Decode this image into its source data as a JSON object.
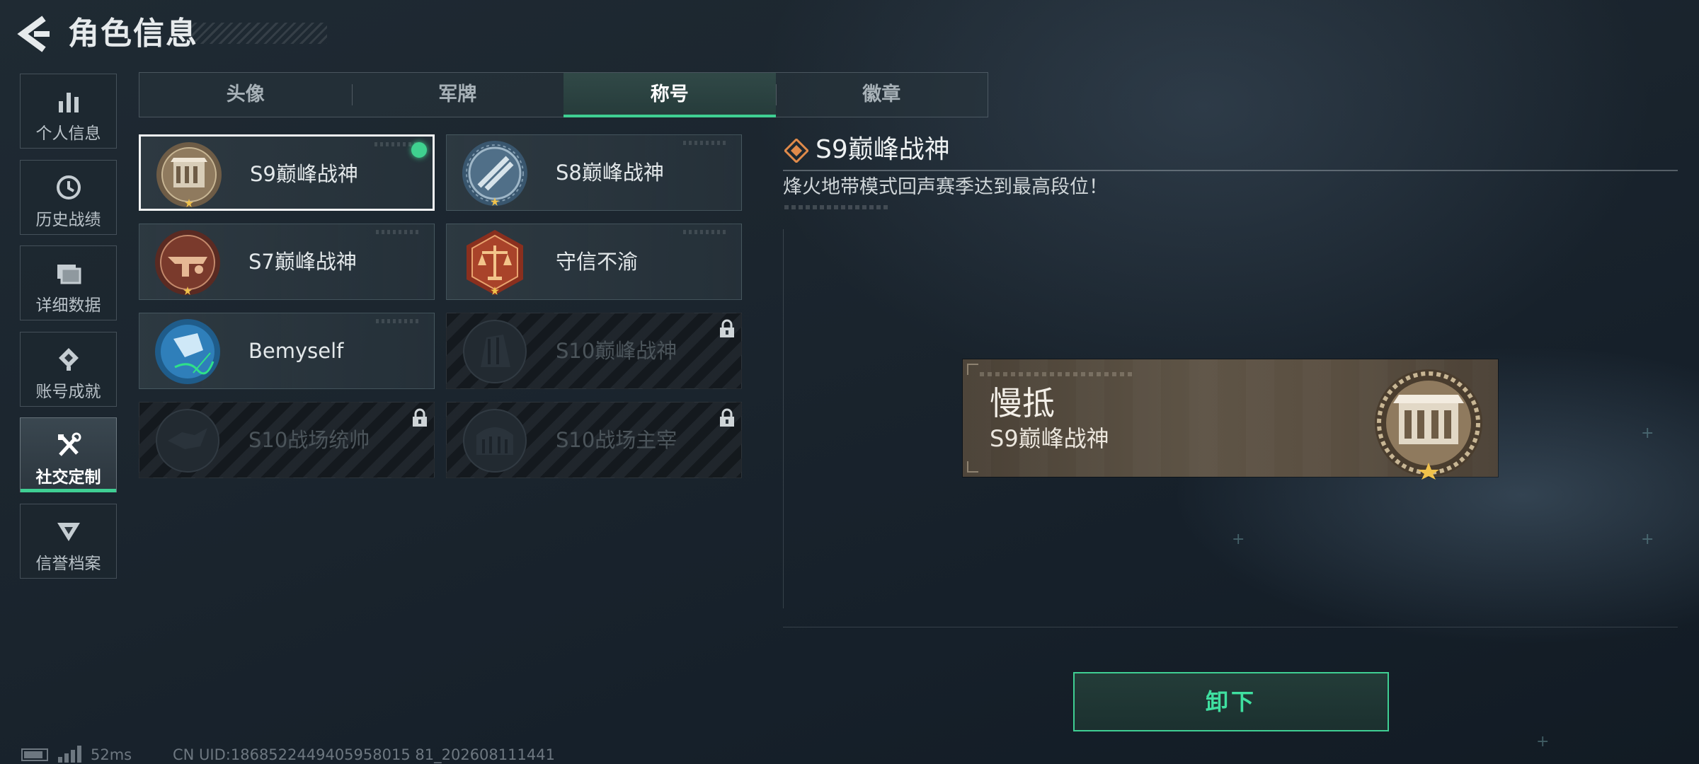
{
  "header": {
    "title": "角色信息"
  },
  "sidebar": {
    "items": [
      {
        "label": "个人信息",
        "icon": "bar-chart-icon"
      },
      {
        "label": "历史战绩",
        "icon": "clock-icon"
      },
      {
        "label": "详细数据",
        "icon": "folder-icon"
      },
      {
        "label": "账号成就",
        "icon": "achievement-icon"
      },
      {
        "label": "社交定制",
        "icon": "tools-icon",
        "active": true
      },
      {
        "label": "信誉档案",
        "icon": "shield-badge-icon"
      }
    ]
  },
  "tabs": [
    {
      "label": "头像"
    },
    {
      "label": "军牌"
    },
    {
      "label": "称号",
      "active": true
    },
    {
      "label": "徽章"
    }
  ],
  "cards": [
    {
      "name": "S9巅峰战神",
      "state": "selected-equipped"
    },
    {
      "name": "S8巅峰战神",
      "state": "unlocked"
    },
    {
      "name": "S7巅峰战神",
      "state": "unlocked"
    },
    {
      "name": "守信不渝",
      "state": "unlocked"
    },
    {
      "name": "Bemyself",
      "state": "unlocked"
    },
    {
      "name": "S10巅峰战神",
      "state": "locked"
    },
    {
      "name": "S10战场统帅",
      "state": "locked"
    },
    {
      "name": "S10战场主宰",
      "state": "locked"
    }
  ],
  "detail": {
    "title": "S9巅峰战神",
    "description": "烽火地带模式回声赛季达到最高段位！"
  },
  "preview": {
    "player_name": "慢抵",
    "title": "S9巅峰战神"
  },
  "actions": {
    "unequip_label": "卸下"
  },
  "status_bar": {
    "ping": "52ms",
    "uid": "CN UID:1868522449405958015 81_202608111441"
  },
  "colors": {
    "accent": "#3fcf93",
    "background": "#1b252e",
    "plate": "#5a4f41"
  }
}
